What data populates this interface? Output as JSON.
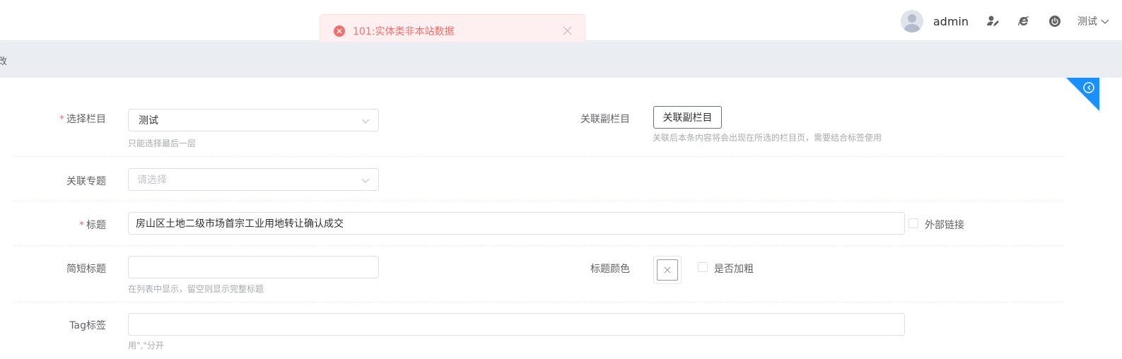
{
  "header": {
    "username": "admin",
    "language": "测试",
    "icons": [
      "user-edit-icon",
      "ie-browser-icon",
      "power-icon"
    ]
  },
  "toast": {
    "message": "101:实体类非本站数据",
    "type": "error",
    "color": "#f56c6c"
  },
  "breadcrumb": {
    "text": "改"
  },
  "form": {
    "column": {
      "label": "选择栏目",
      "value": "测试",
      "hint": "只能选择最后一层"
    },
    "sub_column": {
      "label": "关联副栏目",
      "button": "关联副栏目",
      "hint": "关联后本条内容将会出现在所选的栏目页，需要结合标签使用"
    },
    "topic": {
      "label": "关联专题",
      "placeholder": "请选择"
    },
    "title": {
      "label": "标题",
      "value": "房山区土地二级市场首宗工业用地转让确认成交",
      "external_link_label": "外部链接"
    },
    "short_title": {
      "label": "简短标题",
      "value": "",
      "hint": "在列表中显示，留空则显示完整标题"
    },
    "title_color": {
      "label": "标题颜色",
      "bold_label": "是否加粗"
    },
    "tags": {
      "label": "Tag标签",
      "value": "",
      "hint": "用\",\"分开"
    }
  },
  "colors": {
    "accent": "#1890ff",
    "required": "#f56c6c"
  }
}
